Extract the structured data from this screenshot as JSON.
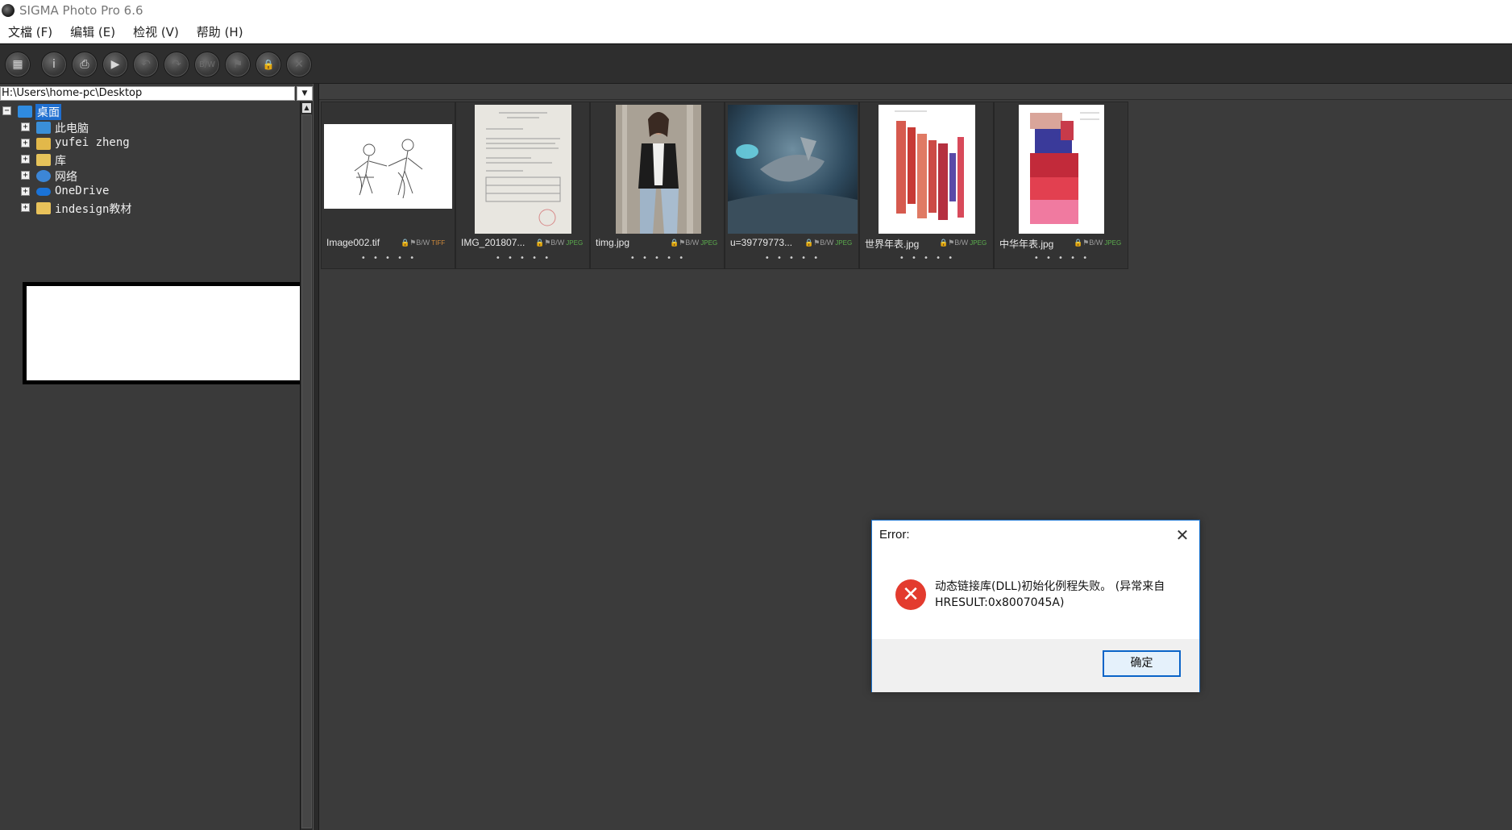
{
  "window": {
    "title": "SIGMA Photo Pro 6.6"
  },
  "menu": [
    "文檔 (F)",
    "编辑 (E)",
    "检视 (V)",
    "帮助 (H)"
  ],
  "toolbar": {
    "buttons": [
      {
        "icon": "grid-icon",
        "glyph": "▦"
      },
      {
        "icon": "info-icon",
        "glyph": "i"
      },
      {
        "icon": "print-icon",
        "glyph": "⎙"
      },
      {
        "icon": "play-icon",
        "glyph": "▶"
      },
      {
        "icon": "rotate-left-icon",
        "glyph": "↶"
      },
      {
        "icon": "rotate-right-icon",
        "glyph": "↷"
      },
      {
        "icon": "bw-icon",
        "glyph": "B/W"
      },
      {
        "icon": "flag-icon",
        "glyph": "⚑"
      },
      {
        "icon": "lock-icon",
        "glyph": "🔒"
      },
      {
        "icon": "delete-icon",
        "glyph": "✕"
      }
    ]
  },
  "path": {
    "value": "H:\\Users\\home-pc\\Desktop"
  },
  "tree": {
    "root": {
      "label": "桌面",
      "icon": "desktop-icon",
      "expander": "−"
    },
    "items": [
      {
        "label": "此电脑",
        "icon": "computer-icon",
        "expander": "+"
      },
      {
        "label": "yufei zheng",
        "icon": "user-folder-icon",
        "expander": "+"
      },
      {
        "label": "库",
        "icon": "library-icon",
        "expander": "+"
      },
      {
        "label": "网络",
        "icon": "network-icon",
        "expander": "+"
      },
      {
        "label": "OneDrive",
        "icon": "onedrive-icon",
        "expander": "+"
      },
      {
        "label": "indesign教材",
        "icon": "folder-icon",
        "expander": "+"
      }
    ]
  },
  "thumbnails": [
    {
      "name": "Image002.tif",
      "format": "TIFF",
      "tag": "B/W",
      "rating": "• • • • •",
      "format_color": "#d08a3a"
    },
    {
      "name": "IMG_201807...",
      "format": "JPEG",
      "tag": "B/W",
      "rating": "• • • • •",
      "format_color": "#5cae4e"
    },
    {
      "name": "timg.jpg",
      "format": "JPEG",
      "tag": "B/W",
      "rating": "• • • • •",
      "format_color": "#5cae4e"
    },
    {
      "name": "u=39779773...",
      "format": "JPEG",
      "tag": "B/W",
      "rating": "• • • • •",
      "format_color": "#5cae4e"
    },
    {
      "name": "世界年表.jpg",
      "format": "JPEG",
      "tag": "B/W",
      "rating": "• • • • •",
      "format_color": "#5cae4e"
    },
    {
      "name": "中华年表.jpg",
      "format": "JPEG",
      "tag": "B/W",
      "rating": "• • • • •",
      "format_color": "#5cae4e"
    }
  ],
  "dialog": {
    "title": "Error:",
    "close_glyph": "✕",
    "error_glyph": "✕",
    "message_line1": "动态链接库(DLL)初始化例程失败。 (异常来自",
    "message_line2": "HRESULT:0x8007045A)",
    "ok_label": "确定"
  }
}
